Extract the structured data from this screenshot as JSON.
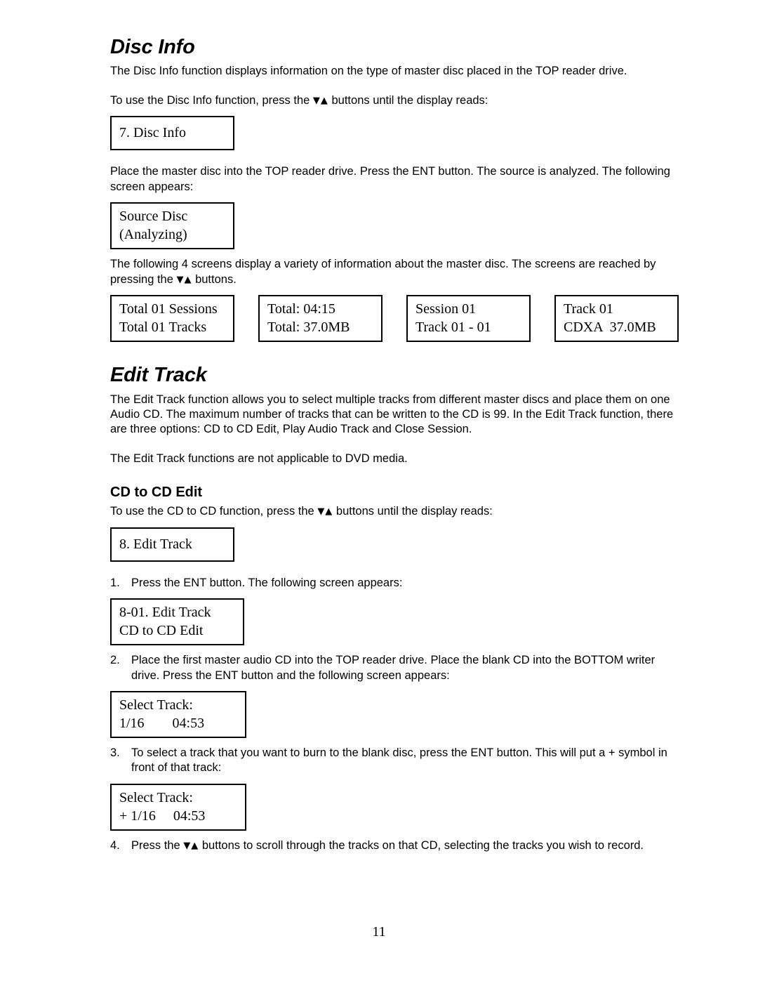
{
  "document": {
    "page_number": "11"
  },
  "disc_info": {
    "heading": "Disc Info",
    "intro": "The Disc Info function displays information on the type of master disc placed in the TOP reader drive.",
    "instruction_pre": "To use the Disc Info function, press the ",
    "arrows": "▼▲",
    "instruction_post": " buttons until the display reads:",
    "menu_screen": "7. Disc Info",
    "place_disc": "Place the master disc into the TOP reader drive.  Press the ENT button.  The source is analyzed.  The following screen appears:",
    "analyzing_screen": {
      "line1": "Source Disc",
      "line2": "(Analyzing)"
    },
    "four_screens_pre": "The following 4 screens display a variety of information about the master disc.  The screens are reached by pressing the ",
    "four_screens_post": " buttons.",
    "screens": [
      {
        "line1": "Total 01 Sessions",
        "line2": "Total 01 Tracks"
      },
      {
        "line1": "Total: 04:15",
        "line2": "Total: 37.0MB"
      },
      {
        "line1": "Session 01",
        "line2": "Track 01 - 01"
      },
      {
        "line1": "Track 01",
        "line2": "CDXA  37.0MB"
      }
    ]
  },
  "edit_track": {
    "heading": "Edit Track",
    "description": "The Edit Track function allows you to select multiple tracks from different master discs and place them on one Audio CD.  The maximum number of tracks that can be written to the CD is 99.  In the Edit Track function, there are three options:  CD to CD Edit, Play Audio Track and Close Session.",
    "dvd_note": "The Edit Track functions are not applicable to DVD media.",
    "cd_to_cd": {
      "heading": "CD to CD Edit",
      "instruction_pre": "To use the CD to CD function, press the ",
      "instruction_post": " buttons until the display reads:",
      "menu_screen": "8. Edit Track",
      "steps": [
        {
          "number": "1.",
          "text": "Press the ENT button.  The following screen appears:"
        },
        {
          "number": "2.",
          "text": "Place the first master audio CD into the TOP reader drive.  Place the blank CD into the BOTTOM writer drive.  Press the ENT button and the following screen appears:"
        },
        {
          "number": "3.",
          "text": "To select a track that you want to burn to the blank disc, press the ENT button.  This will put a + symbol in front of that track:"
        }
      ],
      "step4": {
        "number": "4.",
        "text_pre": "Press the ",
        "text_post": " buttons to scroll through the tracks on that CD, selecting the tracks you wish to record."
      },
      "edit_track_screen": {
        "line1": "8-01. Edit Track",
        "line2": "CD to CD Edit"
      },
      "select_track_screen": {
        "line1": "Select Track:",
        "line2": "1/16        04:53"
      },
      "select_track_plus_screen": {
        "line1": "Select Track:",
        "line2": "+ 1/16     04:53"
      }
    }
  }
}
